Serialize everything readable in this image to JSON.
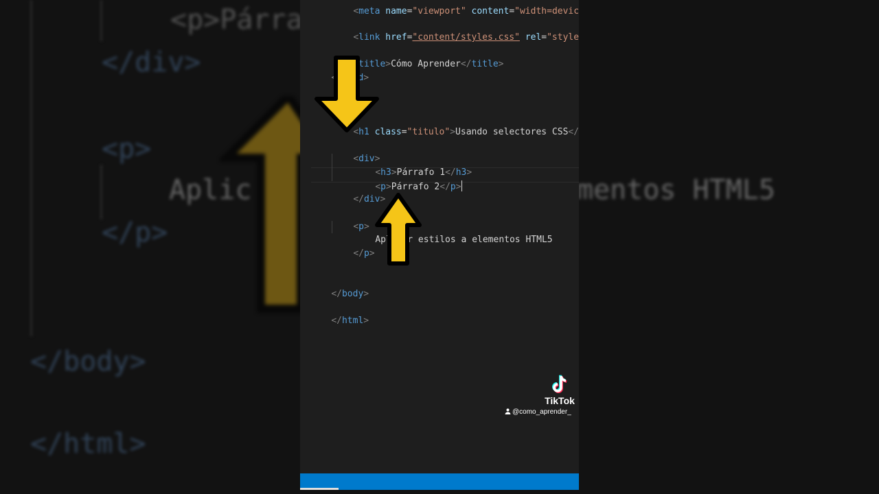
{
  "background": {
    "line_p_open": "<p>Párra",
    "line_div_close": "</div>",
    "line_p2_open": "<p>",
    "line_aplic": "Aplic",
    "line_html5": "mentos HTML5",
    "line_p_close": "</p>",
    "line_body_close": "</body>",
    "line_html_close": "</html>"
  },
  "editor": {
    "lines": [
      {
        "id": "meta",
        "text": "<meta name=\"viewport\" content=\"width=device-w"
      },
      {
        "id": "link_open",
        "text": "<"
      },
      {
        "id": "link_tag",
        "text": "link"
      },
      {
        "id": "link_href",
        "text": "href"
      },
      {
        "id": "link_href_val",
        "text": "\"content/styles.css\""
      },
      {
        "id": "link_rel",
        "text": "rel"
      },
      {
        "id": "link_rel_val",
        "text": "\"styleshe"
      }
    ],
    "title_text": "Cómo Aprender",
    "h1_class_val": "\"titulo\"",
    "h1_text": "Usando selectores CSS",
    "h3_text": "Párrafo 1",
    "p_text": "Párrafo 2",
    "p2_text": "Aplicar estilos a elementos HTML5",
    "colors": {
      "editor_bg": "#1e1e1e",
      "tag_name": "#569cd6",
      "attr_name": "#9cdcfe",
      "attr_value": "#ce9178",
      "bracket": "#808080",
      "status_bar": "#007acc",
      "arrow_fill": "#f5c518"
    }
  },
  "overlay": {
    "arrow_down_icon": "arrow-down-icon",
    "arrow_up_icon": "arrow-up-icon"
  },
  "watermark": {
    "brand": "TikTok",
    "username": "@como_aprender_"
  }
}
